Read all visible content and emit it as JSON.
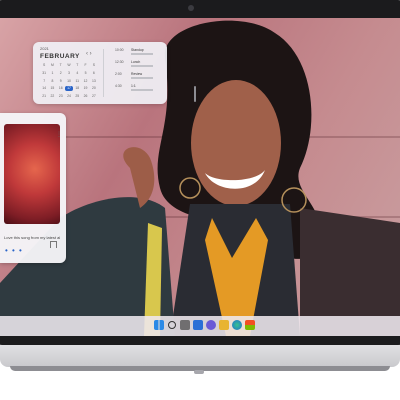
{
  "calendar": {
    "year": "2021",
    "month": "FEBRUARY",
    "nav": "‹ ›",
    "selected_day": "17",
    "weekdays": [
      "S",
      "M",
      "T",
      "W",
      "T",
      "F",
      "S"
    ],
    "days": [
      "31",
      "1",
      "2",
      "3",
      "4",
      "5",
      "6",
      "7",
      "8",
      "9",
      "10",
      "11",
      "12",
      "13",
      "14",
      "15",
      "16",
      "17",
      "18",
      "19",
      "20",
      "21",
      "22",
      "23",
      "24",
      "25",
      "26",
      "27"
    ],
    "events": [
      {
        "time": "10:00",
        "title": "Standup"
      },
      {
        "time": "12:30",
        "title": "Lunch"
      },
      {
        "time": "2:00",
        "title": "Review"
      },
      {
        "time": "4:30",
        "title": "1:1"
      }
    ]
  },
  "music": {
    "caption": "Love this song from my latest album",
    "menu_icon": "more-vertical-icon",
    "pager": "• • •"
  },
  "taskbar": {
    "icons": [
      "windows-start-icon",
      "search-icon",
      "task-view-icon",
      "widgets-icon",
      "chat-icon",
      "file-explorer-icon",
      "edge-icon",
      "store-icon"
    ]
  },
  "colors": {
    "accent": "#2a64c8"
  }
}
